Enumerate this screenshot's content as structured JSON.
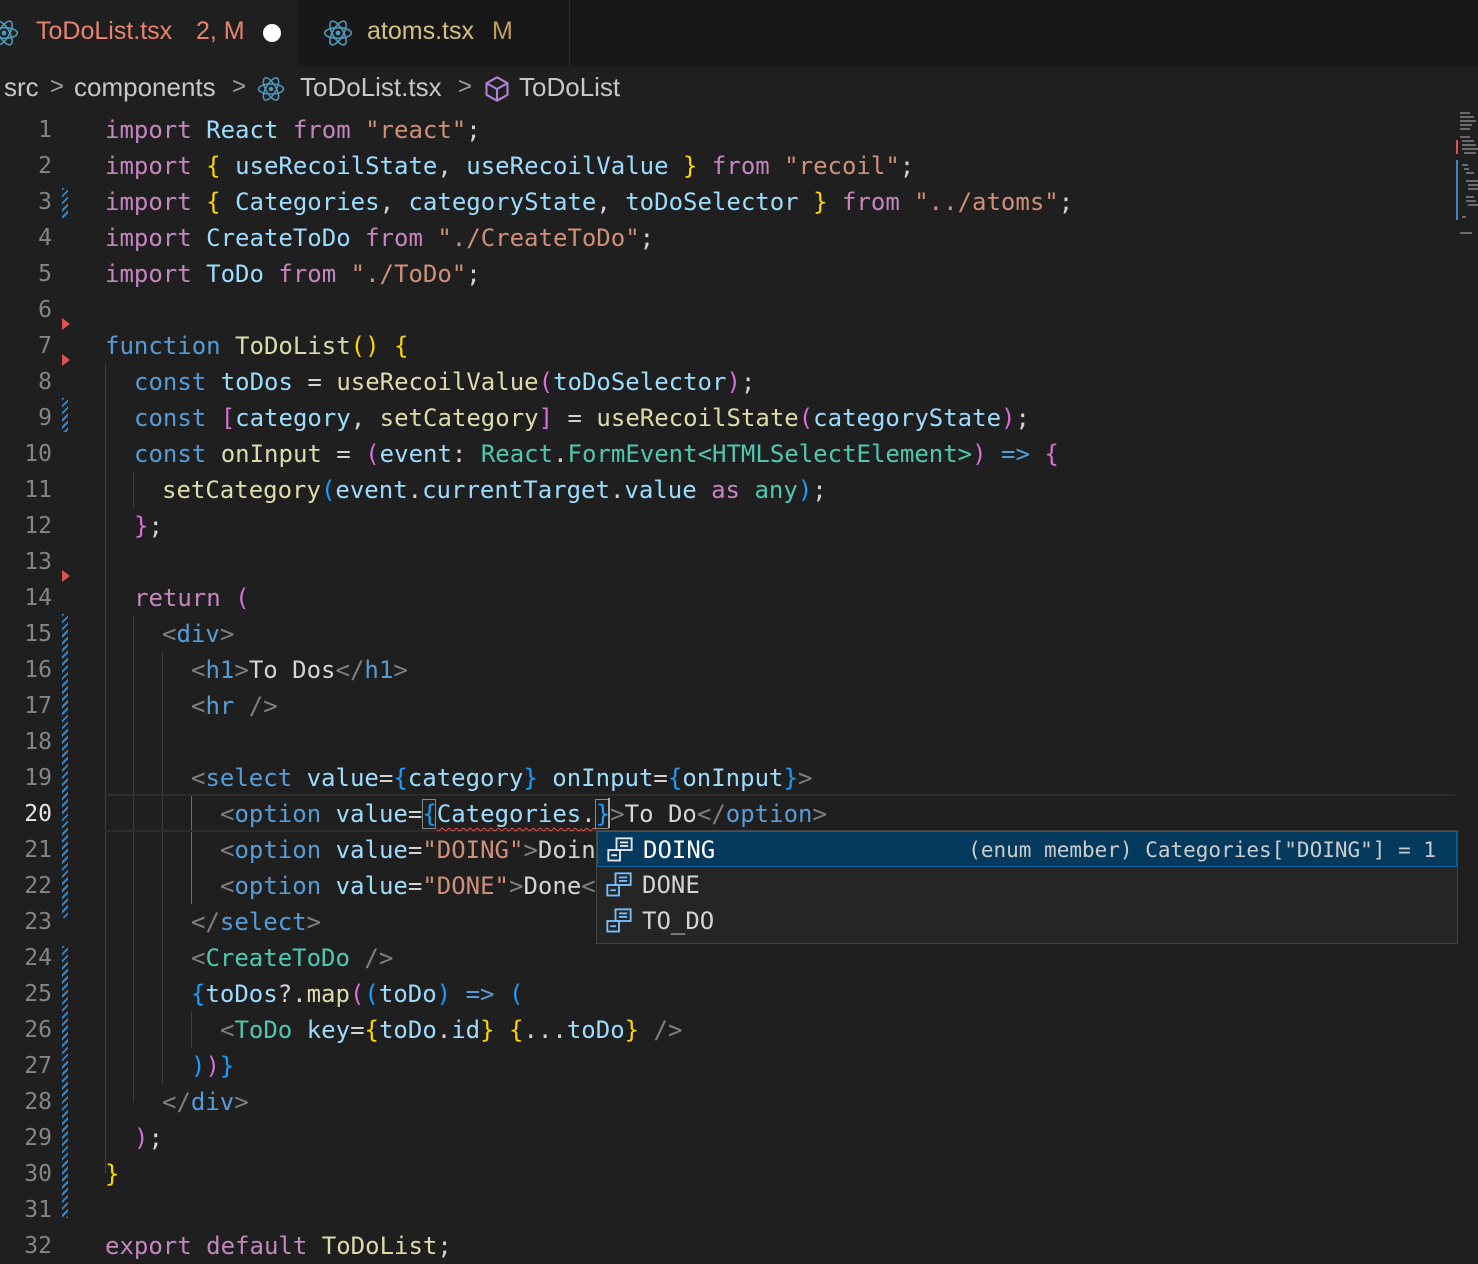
{
  "tabs": [
    {
      "name": "ToDoList.tsx",
      "status": "2, M",
      "dirty": true,
      "active": true
    },
    {
      "name": "atoms.tsx",
      "status": "M",
      "active": false
    }
  ],
  "breadcrumb": {
    "parts": [
      "src",
      "components",
      "ToDoList.tsx",
      "ToDoList"
    ],
    "separator": ">"
  },
  "editor": {
    "current_line": "20",
    "line_numbers": [
      "1",
      "2",
      "3",
      "4",
      "5",
      "6",
      "7",
      "8",
      "9",
      "10",
      "11",
      "12",
      "13",
      "14",
      "15",
      "16",
      "17",
      "18",
      "19",
      "20",
      "21",
      "22",
      "23",
      "24",
      "25",
      "26",
      "27",
      "28",
      "29",
      "30",
      "31",
      "32"
    ],
    "code": {
      "l1": [
        "import",
        " ",
        "React",
        " ",
        "from",
        " ",
        "\"react\"",
        ";"
      ],
      "l2": [
        "import",
        " ",
        "{",
        " ",
        "useRecoilState",
        ", ",
        "useRecoilValue",
        " ",
        "}",
        " ",
        "from",
        " ",
        "\"recoil\"",
        ";"
      ],
      "l3": [
        "import",
        " ",
        "{",
        " ",
        "Categories",
        ", ",
        "categoryState",
        ", ",
        "toDoSelector",
        " ",
        "}",
        " ",
        "from",
        " ",
        "\"../atoms\"",
        ";"
      ],
      "l4": [
        "import",
        " ",
        "CreateToDo",
        " ",
        "from",
        " ",
        "\"./CreateToDo\"",
        ";"
      ],
      "l5": [
        "import",
        " ",
        "ToDo",
        " ",
        "from",
        " ",
        "\"./ToDo\"",
        ";"
      ],
      "l7": [
        "function",
        " ",
        "ToDoList",
        "()",
        " ",
        "{"
      ],
      "l8": [
        "const",
        " ",
        "toDos",
        " = ",
        "useRecoilValue",
        "(",
        "toDoSelector",
        ")",
        ";"
      ],
      "l9": [
        "const",
        " ",
        "[",
        "category",
        ", ",
        "setCategory",
        "]",
        " = ",
        "useRecoilState",
        "(",
        "categoryState",
        ")",
        ";"
      ],
      "l10": [
        "const",
        " ",
        "onInput",
        " = ",
        "(",
        "event",
        ": ",
        "React",
        ".",
        "FormEvent",
        "<",
        "HTMLSelectElement",
        ">",
        ")",
        " ",
        "=>",
        " ",
        "{"
      ],
      "l11": [
        "setCategory",
        "(",
        "event",
        ".",
        "currentTarget",
        ".",
        "value",
        " ",
        "as",
        " ",
        "any",
        ")",
        ";"
      ],
      "l12": [
        "}",
        ";"
      ],
      "l14": [
        "return",
        " ",
        "("
      ],
      "l15": [
        "<",
        "div",
        ">"
      ],
      "l16": [
        "<",
        "h1",
        ">",
        "To Dos",
        "</",
        "h1",
        ">"
      ],
      "l17": [
        "<",
        "hr",
        " />"
      ],
      "l19": [
        "<",
        "select",
        " ",
        "value",
        "=",
        "{",
        "category",
        "}",
        " ",
        "onInput",
        "=",
        "{",
        "onInput",
        "}",
        ">"
      ],
      "l20": [
        "<",
        "option",
        " ",
        "value",
        "=",
        "{",
        "Categories",
        ".",
        "}",
        ">",
        "To Do",
        "</",
        "option",
        ">"
      ],
      "l21": [
        "<",
        "option",
        " ",
        "value",
        "=",
        "\"DOING\"",
        ">",
        "Doin"
      ],
      "l22": [
        "<",
        "option",
        " ",
        "value",
        "=",
        "\"DONE\"",
        ">",
        "Done",
        "<"
      ],
      "l23": [
        "</",
        "select",
        ">"
      ],
      "l24": [
        "<",
        "CreateToDo",
        " />"
      ],
      "l25": [
        "{",
        "toDos",
        "?.",
        "map",
        "(",
        "(",
        "toDo",
        ")",
        " ",
        "=>",
        " ",
        "("
      ],
      "l26": [
        "<",
        "ToDo",
        " ",
        "key",
        "=",
        "{",
        "toDo",
        ".",
        "id",
        "}",
        " ",
        "{",
        "...",
        "toDo",
        "}",
        " />"
      ],
      "l27": [
        ")",
        ")",
        "}"
      ],
      "l28": [
        "</",
        "div",
        ">"
      ],
      "l29": [
        ")",
        ";"
      ],
      "l30": [
        "}"
      ],
      "l32": [
        "export",
        " ",
        "default",
        " ",
        "ToDoList",
        ";"
      ]
    }
  },
  "suggest": {
    "items": [
      {
        "label": "DOING",
        "detail": "(enum member) Categories[\"DOING\"] = 1",
        "selected": true,
        "icon": "enum-member-icon"
      },
      {
        "label": "DONE",
        "detail": "",
        "selected": false,
        "icon": "enum-member-icon"
      },
      {
        "label": "TO_DO",
        "detail": "",
        "selected": false,
        "icon": "enum-member-icon"
      }
    ]
  },
  "colors": {
    "background": "#1f1f1f",
    "keyword": "#c586c0",
    "storage": "#569cd6",
    "variable": "#9cdcfe",
    "function": "#dcdcaa",
    "string": "#ce9178",
    "type": "#4ec9b0",
    "modified_tab": "#e8846f",
    "suggest_selected": "#04395e"
  }
}
